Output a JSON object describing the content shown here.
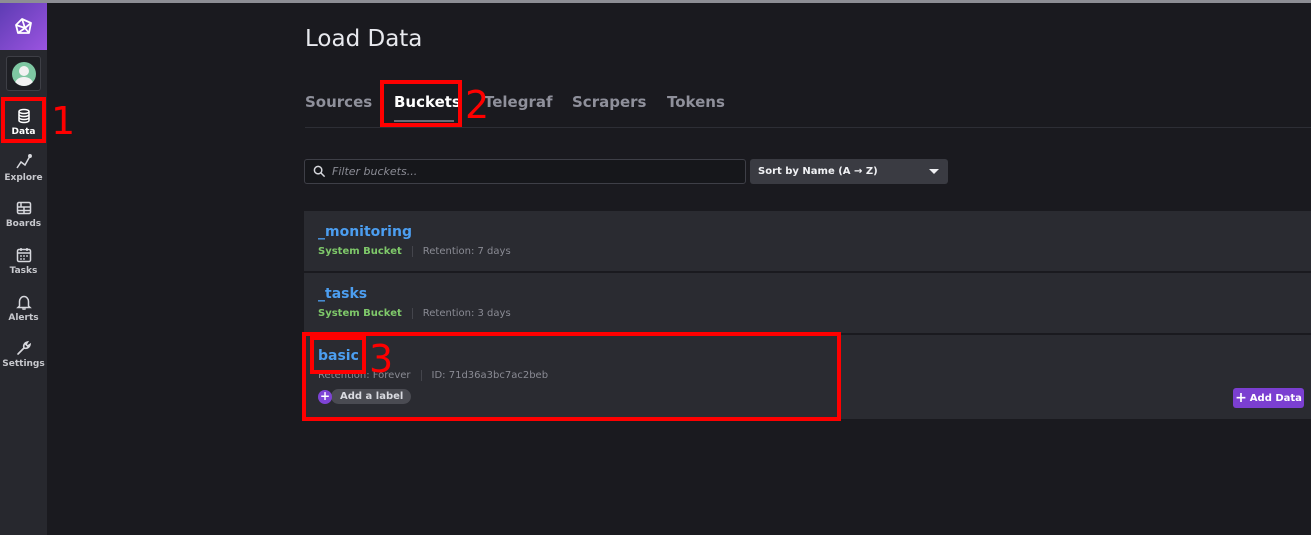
{
  "app": {
    "page_title": "Load Data"
  },
  "sidebar": {
    "items": [
      {
        "label": "Data",
        "icon": "database-icon",
        "active": true
      },
      {
        "label": "Explore",
        "icon": "graph-icon",
        "active": false
      },
      {
        "label": "Boards",
        "icon": "dashboard-grid-icon",
        "active": false
      },
      {
        "label": "Tasks",
        "icon": "calendar-icon",
        "active": false
      },
      {
        "label": "Alerts",
        "icon": "bell-icon",
        "active": false
      },
      {
        "label": "Settings",
        "icon": "wrench-icon",
        "active": false
      }
    ]
  },
  "tabs": [
    {
      "label": "Sources",
      "active": false
    },
    {
      "label": "Buckets",
      "active": true
    },
    {
      "label": "Telegraf",
      "active": false
    },
    {
      "label": "Scrapers",
      "active": false
    },
    {
      "label": "Tokens",
      "active": false
    }
  ],
  "filter": {
    "placeholder": "Filter buckets...",
    "value": ""
  },
  "sort": {
    "label": "Sort by Name (A → Z)"
  },
  "buckets": [
    {
      "name": "_monitoring",
      "type": "System Bucket",
      "retention": "Retention: 7 days"
    },
    {
      "name": "_tasks",
      "type": "System Bucket",
      "retention": "Retention: 3 days"
    },
    {
      "name": "basic",
      "retention": "Retention: Forever",
      "id": "ID: 71d36a3bc7ac2beb",
      "add_label": "Add a label",
      "add_data": "Add Data"
    }
  ],
  "annotations": [
    "1",
    "2",
    "3"
  ],
  "colors": {
    "accent_purple": "#7b3fd1",
    "link_blue": "#4c9ef0",
    "system_green": "#7fc96a",
    "annotation_red": "#ff0000"
  }
}
